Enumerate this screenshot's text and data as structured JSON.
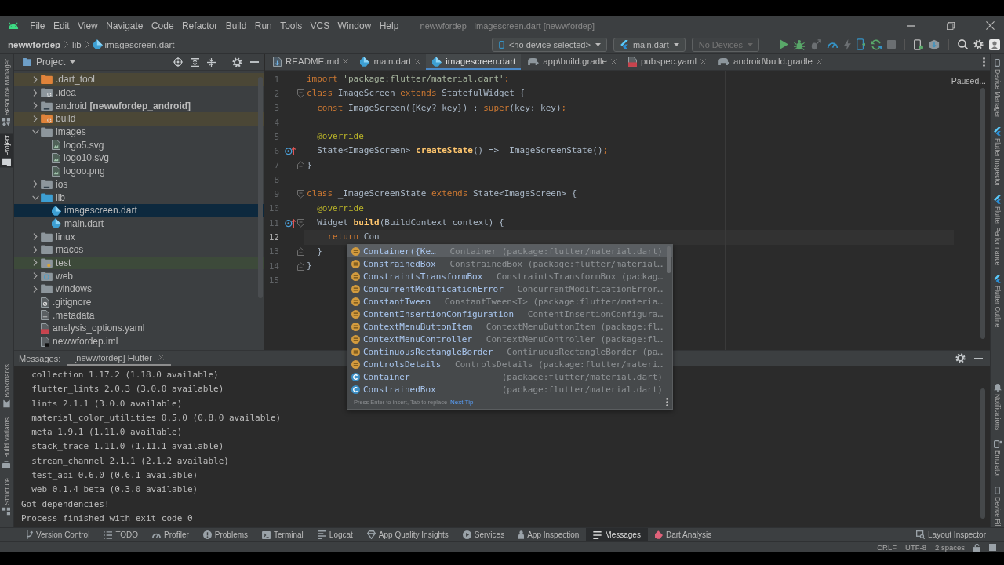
{
  "window": {
    "title": "newwfordep - imagescreen.dart [newwfordep]",
    "menu": [
      "File",
      "Edit",
      "View",
      "Navigate",
      "Code",
      "Refactor",
      "Build",
      "Run",
      "Tools",
      "VCS",
      "Window",
      "Help"
    ]
  },
  "navigation_bar": {
    "breadcrumbs": [
      {
        "label": "newwfordep",
        "kind": "project"
      },
      {
        "label": "lib",
        "kind": "folder"
      },
      {
        "label": "imagescreen.dart",
        "kind": "dart"
      }
    ],
    "device_selector": "<no device selected>",
    "run_configuration": "main.dart",
    "target": {
      "label": "No Devices",
      "disabled": true
    },
    "buttons": [
      {
        "kind": "run",
        "disabled": false
      },
      {
        "kind": "debug",
        "disabled": false
      },
      {
        "kind": "attach",
        "disabled": true
      },
      {
        "kind": "profile",
        "disabled": false
      },
      {
        "kind": "reload",
        "disabled": true
      },
      {
        "kind": "apply",
        "disabled": false
      },
      {
        "kind": "sync",
        "disabled": false
      },
      {
        "kind": "stop",
        "disabled": true
      },
      {
        "kind": "devices",
        "disabled": false
      },
      {
        "kind": "sdk",
        "disabled": false
      },
      {
        "kind": "search",
        "disabled": false
      },
      {
        "kind": "settings",
        "disabled": false
      },
      {
        "kind": "account",
        "disabled": false
      }
    ]
  },
  "left_stripe": {
    "top": [
      {
        "label": "Resource Manager",
        "kind": "resources",
        "selected": false
      },
      {
        "label": "Project",
        "kind": "project",
        "selected": true
      }
    ],
    "bottom": [
      {
        "label": "Bookmarks",
        "kind": "bookmarks",
        "selected": false
      },
      {
        "label": "Build Variants",
        "kind": "variants",
        "selected": false
      },
      {
        "label": "Structure",
        "kind": "structure",
        "selected": false
      }
    ]
  },
  "right_stripe": {
    "top": [
      {
        "label": "Device Manager",
        "kind": "device",
        "selected": false
      },
      {
        "label": "Flutter Inspector",
        "kind": "flutter",
        "selected": false
      },
      {
        "label": "Flutter Performance",
        "kind": "flutter",
        "selected": false
      },
      {
        "label": "Flutter Outline",
        "kind": "flutter",
        "selected": false
      }
    ],
    "bottom": [
      {
        "label": "Notifications",
        "kind": "bell",
        "selected": false
      },
      {
        "label": "Emulator",
        "kind": "emulator",
        "selected": false
      },
      {
        "label": "Device Fil",
        "kind": "device",
        "selected": false
      }
    ]
  },
  "project_panel": {
    "title": "Project",
    "tree": [
      {
        "label": ".dart_tool",
        "kind": "folder-excluded",
        "expanded": false,
        "selected": false
      },
      {
        "label": ".idea",
        "kind": "folder-config",
        "expanded": false,
        "selected": false
      },
      {
        "label": "android **[newwfordep_android]**",
        "kind": "folder-module",
        "expanded": false,
        "selected": false
      },
      {
        "label": "build",
        "kind": "folder-build",
        "expanded": false,
        "selected": false
      },
      {
        "label": "images",
        "kind": "folder",
        "expanded": true,
        "selected": false,
        "children": [
          {
            "label": "logo5.svg",
            "kind": "image-file",
            "selected": false
          },
          {
            "label": "logo10.svg",
            "kind": "image-file",
            "selected": false
          },
          {
            "label": "logoo.png",
            "kind": "image-file",
            "selected": false
          }
        ]
      },
      {
        "label": "ios",
        "kind": "folder-module",
        "expanded": false,
        "selected": false
      },
      {
        "label": "lib",
        "kind": "folder-source",
        "expanded": true,
        "selected": false,
        "children": [
          {
            "label": "imagescreen.dart",
            "kind": "dart-file",
            "selected": true
          },
          {
            "label": "main.dart",
            "kind": "dart-file",
            "selected": false
          }
        ]
      },
      {
        "label": "linux",
        "kind": "folder",
        "expanded": false,
        "selected": false
      },
      {
        "label": "macos",
        "kind": "folder",
        "expanded": false,
        "selected": false
      },
      {
        "label": "test",
        "kind": "folder-test",
        "expanded": false,
        "selected": false
      },
      {
        "label": "web",
        "kind": "folder-web",
        "expanded": false,
        "selected": false
      },
      {
        "label": "windows",
        "kind": "folder",
        "expanded": false,
        "selected": false
      },
      {
        "label": ".gitignore",
        "kind": "ignore-file",
        "selected": false
      },
      {
        "label": ".metadata",
        "kind": "text-file",
        "selected": false
      },
      {
        "label": "analysis_options.yaml",
        "kind": "yaml-file",
        "selected": false
      },
      {
        "label": "newwfordep.iml",
        "kind": "iml-file",
        "selected": false
      }
    ]
  },
  "editor": {
    "tabs": [
      {
        "label": "README.md",
        "kind": "markdown",
        "selected": false
      },
      {
        "label": "main.dart",
        "kind": "dart",
        "selected": false
      },
      {
        "label": "imagescreen.dart",
        "kind": "dart",
        "selected": true
      },
      {
        "label": "app\\build.gradle",
        "kind": "gradle",
        "selected": false
      },
      {
        "label": "pubspec.yaml",
        "kind": "yaml",
        "selected": false
      },
      {
        "label": "android\\build.gradle",
        "kind": "gradle",
        "selected": false
      }
    ],
    "status": "Paused...",
    "lines": [
      {
        "number": "1",
        "tokens": [
          {
            "kind": "keyword",
            "text": "import"
          },
          {
            "kind": "string",
            "text": " 'package:flutter/material.dart'"
          },
          {
            "kind": "punctuation",
            "text": ";"
          }
        ]
      },
      {
        "number": "2",
        "fold_start": true,
        "tokens": [
          {
            "kind": "keyword",
            "text": "class"
          },
          {
            "kind": "plain",
            "text": " ImageScreen "
          },
          {
            "kind": "keyword",
            "text": "extends"
          },
          {
            "kind": "plain",
            "text": " StatefulWidget {"
          }
        ]
      },
      {
        "number": "3",
        "tokens": [
          {
            "kind": "keyword",
            "text": "  const"
          },
          {
            "kind": "plain",
            "text": " ImageScreen({Key? key}) : "
          },
          {
            "kind": "keyword",
            "text": "super"
          },
          {
            "kind": "plain",
            "text": "(key: key)"
          },
          {
            "kind": "punctuation",
            "text": ";"
          }
        ]
      },
      {
        "number": "4"
      },
      {
        "number": "5",
        "tokens": [
          {
            "kind": "annotation",
            "text": "  @override"
          }
        ]
      },
      {
        "number": "6",
        "override": true,
        "tokens": [
          {
            "kind": "plain",
            "text": "  State<ImageScreen> "
          },
          {
            "kind": "function",
            "text": "createState"
          },
          {
            "kind": "plain",
            "text": "() => _ImageScreenState()"
          },
          {
            "kind": "punctuation",
            "text": ";"
          }
        ]
      },
      {
        "number": "7",
        "fold_end": true,
        "tokens": [
          {
            "kind": "plain",
            "text": "}"
          }
        ]
      },
      {
        "number": "8"
      },
      {
        "number": "9",
        "fold_start": true,
        "tokens": [
          {
            "kind": "keyword",
            "text": "class"
          },
          {
            "kind": "plain",
            "text": " _ImageScreenState "
          },
          {
            "kind": "keyword",
            "text": "extends"
          },
          {
            "kind": "plain",
            "text": " State<ImageScreen> {"
          }
        ]
      },
      {
        "number": "10",
        "tokens": [
          {
            "kind": "annotation",
            "text": "  @override"
          }
        ]
      },
      {
        "number": "11",
        "override": true,
        "fold_start": true,
        "tokens": [
          {
            "kind": "plain",
            "text": "  Widget "
          },
          {
            "kind": "function",
            "text": "build"
          },
          {
            "kind": "plain",
            "text": "(BuildContext context) {"
          }
        ]
      },
      {
        "number": "12",
        "current": true,
        "tokens": [
          {
            "kind": "keyword",
            "text": "    return"
          },
          {
            "kind": "plain",
            "text": " Con"
          }
        ]
      },
      {
        "number": "13",
        "fold_end": true,
        "tokens": [
          {
            "kind": "plain",
            "text": "  }"
          }
        ]
      },
      {
        "number": "14",
        "fold_end": true,
        "tokens": [
          {
            "kind": "plain",
            "text": "}"
          }
        ]
      },
      {
        "number": "15"
      }
    ],
    "completion": {
      "items": [
        {
          "name": "Container({Ke…",
          "detail": "Container (package:flutter/material.dart)",
          "kind": "constructor",
          "selected": true
        },
        {
          "name": "ConstrainedBox",
          "detail": "ConstrainedBox (package:flutter/material…",
          "kind": "constructor",
          "selected": false
        },
        {
          "name": "ConstraintsTransformBox",
          "detail": "ConstraintsTransformBox (packag…",
          "kind": "constructor",
          "selected": false
        },
        {
          "name": "ConcurrentModificationError",
          "detail": "ConcurrentModificationError…",
          "kind": "constructor",
          "selected": false
        },
        {
          "name": "ConstantTween",
          "detail": "ConstantTween<T> (package:flutter/materia…",
          "kind": "constructor",
          "selected": false
        },
        {
          "name": "ContentInsertionConfiguration",
          "detail": "ContentInsertionConfigura…",
          "kind": "constructor",
          "selected": false
        },
        {
          "name": "ContextMenuButtonItem",
          "detail": "ContextMenuButtonItem (package:fl…",
          "kind": "constructor",
          "selected": false
        },
        {
          "name": "ContextMenuController",
          "detail": "ContextMenuController (package:fl…",
          "kind": "constructor",
          "selected": false
        },
        {
          "name": "ContinuousRectangleBorder",
          "detail": "ContinuousRectangleBorder (pa…",
          "kind": "constructor",
          "selected": false
        },
        {
          "name": "ControlsDetails",
          "detail": "ControlsDetails (package:flutter/materi…",
          "kind": "constructor",
          "selected": false
        },
        {
          "name": "Container",
          "detail": "(package:flutter/material.dart)",
          "kind": "class",
          "selected": false
        },
        {
          "name": "ConstrainedBox",
          "detail": "(package:flutter/material.dart)",
          "kind": "class",
          "selected": false
        }
      ],
      "hint": "Press Enter to insert, Tab to replace",
      "link": "Next Tip"
    }
  },
  "bottom_panel": {
    "title": "Messages:",
    "tabs": [
      {
        "label": "[newwfordep] Flutter",
        "selected": true
      }
    ],
    "lines": [
      "  collection 1.17.2 (1.18.0 available)",
      "  flutter_lints 2.0.3 (3.0.0 available)",
      "  lints 2.1.1 (3.0.0 available)",
      "  material_color_utilities 0.5.0 (0.8.0 available)",
      "  meta 1.9.1 (1.11.0 available)",
      "  stack_trace 1.11.0 (1.11.1 available)",
      "  stream_channel 2.1.1 (2.1.2 available)",
      "  test_api 0.6.0 (0.6.1 available)",
      "  web 0.1.4-beta (0.3.0 available)",
      "Got dependencies!",
      "Process finished with exit code 0"
    ]
  },
  "tool_window_bar": {
    "items": [
      {
        "label": "Version Control",
        "kind": "vcs",
        "selected": false
      },
      {
        "label": "TODO",
        "kind": "todo",
        "selected": false
      },
      {
        "label": "Profiler",
        "kind": "profiler",
        "selected": false
      },
      {
        "label": "Problems",
        "kind": "problems",
        "selected": false
      },
      {
        "label": "Terminal",
        "kind": "terminal",
        "selected": false
      },
      {
        "label": "Logcat",
        "kind": "logcat",
        "selected": false
      },
      {
        "label": "App Quality Insights",
        "kind": "aqi",
        "selected": false
      },
      {
        "label": "Services",
        "kind": "services",
        "selected": false
      },
      {
        "label": "App Inspection",
        "kind": "inspection",
        "selected": false
      },
      {
        "label": "Messages",
        "kind": "messages",
        "selected": true
      },
      {
        "label": "Dart Analysis",
        "kind": "dart",
        "selected": false
      }
    ],
    "right": [
      {
        "label": "Layout Inspector",
        "kind": "layout",
        "selected": false
      }
    ]
  },
  "status_bar": {
    "items": [
      "CRLF",
      "UTF-8",
      "2 spaces"
    ]
  }
}
